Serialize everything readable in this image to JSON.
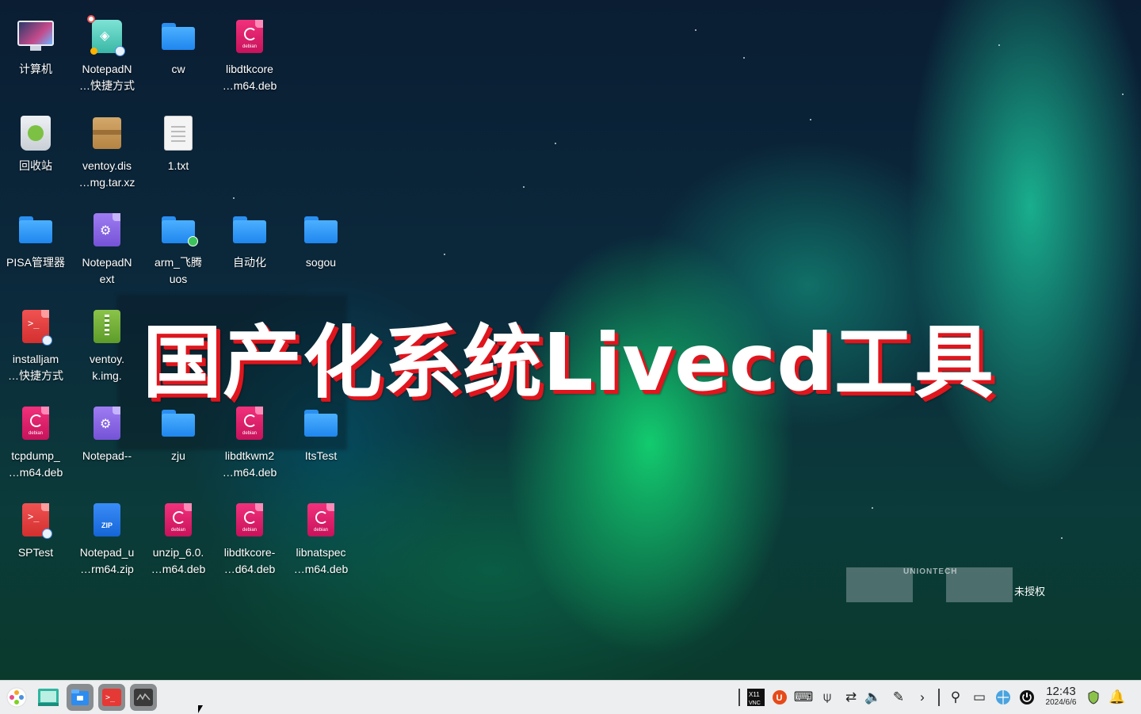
{
  "desktop": {
    "icons": [
      {
        "label": "计算机",
        "kind": "computer"
      },
      {
        "label": "NotepadN\n…快捷方式",
        "kind": "notepad-shortcut"
      },
      {
        "label": "cw",
        "kind": "folder"
      },
      {
        "label": "libdtkcore\n…m64.deb",
        "kind": "deb"
      },
      {
        "label": "回收站",
        "kind": "trash"
      },
      {
        "label": "ventoy.dis\n…mg.tar.xz",
        "kind": "archive"
      },
      {
        "label": "1.txt",
        "kind": "text"
      },
      {
        "label": "PISA管理器",
        "kind": "folder"
      },
      {
        "label": "NotepadN\next",
        "kind": "gear"
      },
      {
        "label": "arm_飞腾\nuos",
        "kind": "folder-badge"
      },
      {
        "label": "自动化",
        "kind": "folder"
      },
      {
        "label": "sogou",
        "kind": "folder"
      },
      {
        "label": "installjam\n…快捷方式",
        "kind": "script"
      },
      {
        "label": "ventoy.\nk.img.",
        "kind": "green-zip"
      },
      {
        "label": "tcpdump_\n…m64.deb",
        "kind": "deb"
      },
      {
        "label": "Notepad--",
        "kind": "gear"
      },
      {
        "label": "zju",
        "kind": "folder"
      },
      {
        "label": "libdtkwm2\n…m64.deb",
        "kind": "deb"
      },
      {
        "label": "ItsTest",
        "kind": "folder"
      },
      {
        "label": "SPTest",
        "kind": "script"
      },
      {
        "label": "Notepad_u\n…rm64.zip",
        "kind": "zip"
      },
      {
        "label": "unzip_6.0.\n…m64.deb",
        "kind": "deb"
      },
      {
        "label": "libdtkcore-\n…d64.deb",
        "kind": "deb"
      },
      {
        "label": "libnatspec\n…m64.deb",
        "kind": "deb"
      }
    ],
    "overlay_title": "国产化系统Livecd工具",
    "watermark": {
      "brand": "UNIONTECH",
      "text": "未授权"
    }
  },
  "taskbar": {
    "apps": [
      {
        "name": "launcher-icon"
      },
      {
        "name": "desktop-icon"
      },
      {
        "name": "file-manager-icon"
      },
      {
        "name": "terminal-icon"
      },
      {
        "name": "system-monitor-icon"
      }
    ],
    "tray": {
      "clock_time": "12:43",
      "clock_date": "2024/6/6"
    }
  },
  "colors": {
    "accent_red": "#e0151d",
    "taskbar_bg": "#eceeef",
    "folder_blue": "#1f86ee",
    "deb_pink": "#d81b60"
  }
}
